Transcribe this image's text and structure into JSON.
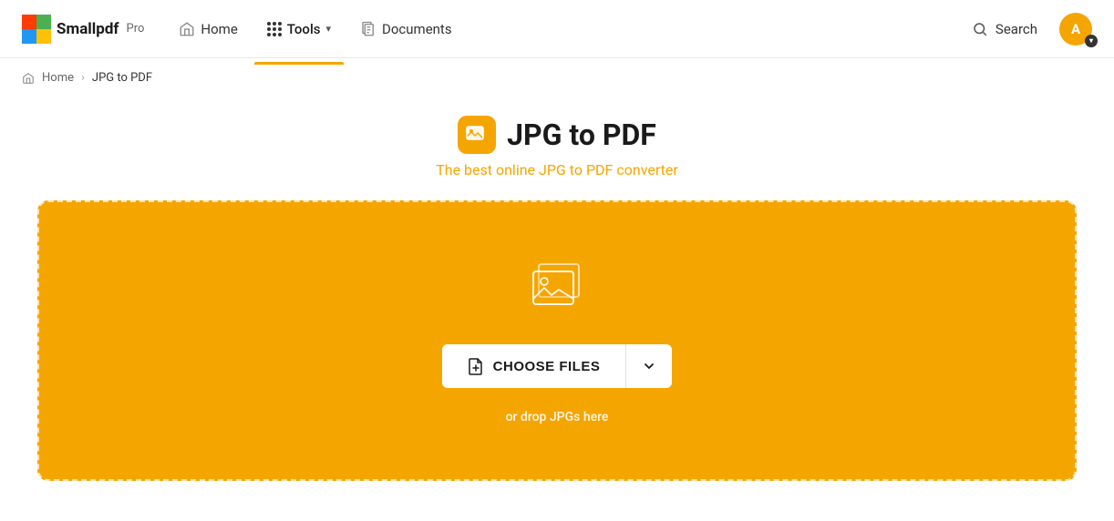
{
  "brand": {
    "logo_text": "Smallpdf",
    "pro_label": "Pro",
    "logo_letter": "A"
  },
  "nav": {
    "home_label": "Home",
    "tools_label": "Tools",
    "documents_label": "Documents",
    "search_label": "Search"
  },
  "breadcrumb": {
    "home": "Home",
    "current": "JPG to PDF"
  },
  "page": {
    "title": "JPG to PDF",
    "subtitle": "The best online JPG to PDF converter"
  },
  "dropzone": {
    "choose_files_label": "CHOOSE FILES",
    "drop_hint": "or drop JPGs here"
  }
}
